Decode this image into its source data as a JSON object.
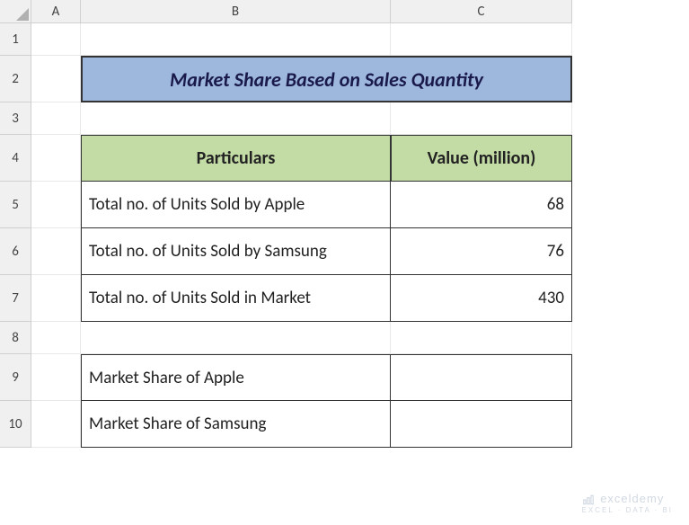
{
  "columns": [
    "A",
    "B",
    "C"
  ],
  "rows": [
    "1",
    "2",
    "3",
    "4",
    "5",
    "6",
    "7",
    "8",
    "9",
    "10"
  ],
  "title": "Market Share Based on Sales Quantity",
  "table_headers": {
    "particulars": "Particulars",
    "value": "Value (million)"
  },
  "data_rows": [
    {
      "label": "Total no. of Units Sold by Apple",
      "value": "68"
    },
    {
      "label": "Total no. of Units Sold by Samsung",
      "value": "76"
    },
    {
      "label": "Total no. of Units Sold in Market",
      "value": "430"
    }
  ],
  "share_rows": [
    {
      "label": "Market Share of Apple",
      "value": ""
    },
    {
      "label": "Market Share of Samsung",
      "value": ""
    }
  ],
  "watermark": {
    "brand": "exceldemy",
    "tagline": "EXCEL · DATA · BI"
  }
}
